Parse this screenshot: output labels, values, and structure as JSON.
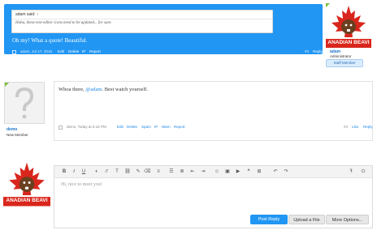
{
  "post1": {
    "quote_author": "adam said: ↑",
    "quote_text": "Haha, these text-editor icons need to be updated... for sure.",
    "message": "Oh my! What a quote! Beautiful.",
    "meta": "adam, Jul 17, 2015",
    "actions": [
      "Edit",
      "Delete",
      "IP",
      "Report"
    ],
    "post_number": "#3",
    "reply_label": "Reply",
    "user": {
      "name": "adam",
      "title": "Administrator",
      "badge": "Staff Member",
      "avatar_text": "ANADIAN BEAVI"
    }
  },
  "post2": {
    "message_prefix": "Whoa there, ",
    "mention": "@adam",
    "message_suffix": ". Best watch yourself.",
    "meta": "demo, Today at 6:42 PM",
    "actions": [
      "Edit",
      "Delete",
      "Spam",
      "IP",
      "Warn",
      "Report"
    ],
    "post_number": "#4",
    "like_label": "Like",
    "reply_label": "Reply",
    "user": {
      "name": "demo",
      "title": "New Member"
    }
  },
  "editor": {
    "placeholder": "Hi, nice to meet you!",
    "post_reply": "Post Reply",
    "upload": "Upload a File",
    "more_options": "More Options...",
    "toolbar": [
      "bold-icon",
      "italic-icon",
      "underline-icon",
      "color-icon",
      "font-size-icon",
      "font-icon",
      "link-icon",
      "unlink-icon",
      "align-icon",
      "bullet-list-icon",
      "number-list-icon",
      "outdent-icon",
      "indent-icon",
      "smilie-icon",
      "image-icon",
      "media-icon",
      "quote-icon",
      "insert-icon",
      "undo-icon",
      "redo-icon",
      "toggle-bbcode-icon",
      "power-icon"
    ]
  },
  "current_user_avatar_text": "ANADIAN BEAVI",
  "colors": {
    "accent": "#2196f3",
    "link": "#1e88e5",
    "flag_red": "#d9261c"
  }
}
